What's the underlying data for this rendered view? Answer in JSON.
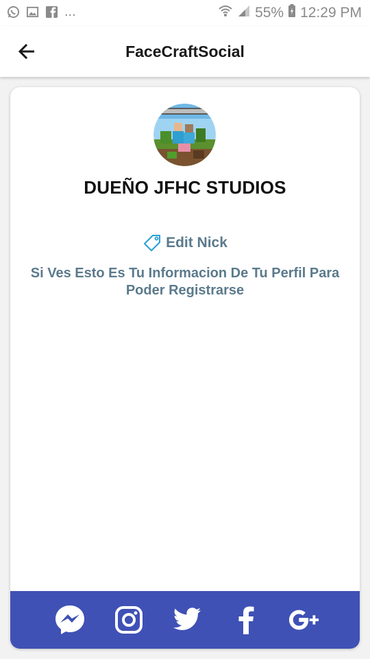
{
  "status_bar": {
    "left_icons": [
      "whatsapp-icon",
      "image-icon",
      "facebook-icon"
    ],
    "overflow": "...",
    "battery": "55%",
    "time": "12:29 PM"
  },
  "app_bar": {
    "title": "FaceCraftSocial",
    "back_icon": "arrow-back-icon"
  },
  "profile": {
    "name": "DUEÑO JFHC STUDIOS",
    "edit_nick_label": "Edit Nick",
    "edit_nick_icon": "tag-icon",
    "info": "Si Ves Esto Es Tu Informacion De Tu Perfil Para Poder Registrarse"
  },
  "social": {
    "icons": [
      "messenger-icon",
      "instagram-icon",
      "twitter-icon",
      "facebook-icon",
      "google-plus-icon"
    ],
    "bar_color": "#3f51b5"
  },
  "colors": {
    "accent_text": "#5b7a8c",
    "social_bar": "#3f51b5"
  }
}
